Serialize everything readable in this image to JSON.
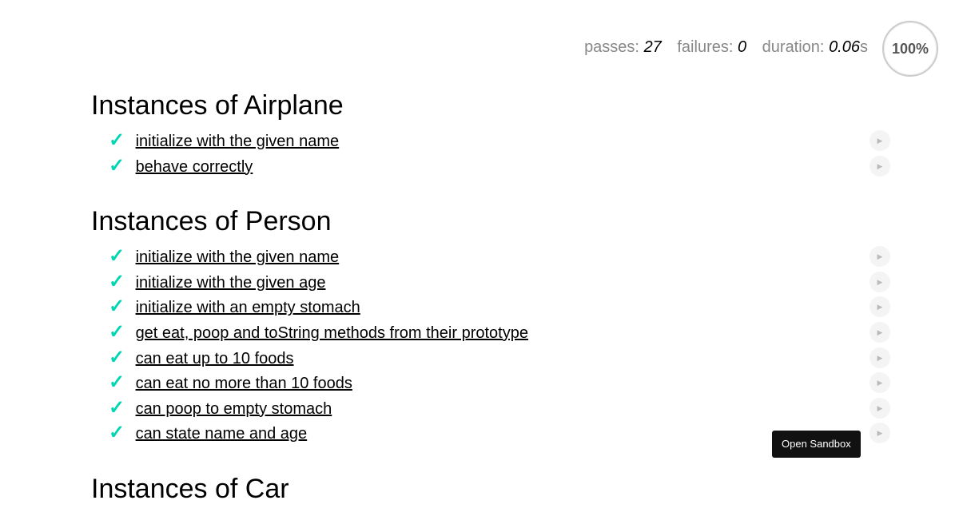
{
  "stats": {
    "passes_label": "passes:",
    "passes": "27",
    "failures_label": "failures:",
    "failures": "0",
    "duration_label": "duration:",
    "duration": "0.06",
    "duration_unit": "s",
    "progress": "100%"
  },
  "suites": [
    {
      "title": "Instances of Airplane",
      "tests": [
        {
          "title": "initialize with the given name",
          "status": "passed"
        },
        {
          "title": "behave correctly",
          "status": "passed"
        }
      ]
    },
    {
      "title": "Instances of Person",
      "tests": [
        {
          "title": "initialize with the given name",
          "status": "passed"
        },
        {
          "title": "initialize with the given age",
          "status": "passed"
        },
        {
          "title": "initialize with an empty stomach",
          "status": "passed"
        },
        {
          "title": "get eat, poop and toString methods from their prototype",
          "status": "passed"
        },
        {
          "title": "can eat up to 10 foods",
          "status": "passed"
        },
        {
          "title": "can eat no more than 10 foods",
          "status": "passed"
        },
        {
          "title": "can poop to empty stomach",
          "status": "passed"
        },
        {
          "title": "can state name and age",
          "status": "passed"
        }
      ]
    },
    {
      "title": "Instances of Car",
      "tests": []
    }
  ],
  "icons": {
    "check": "✓",
    "replay": "▶"
  },
  "tooltip": {
    "text": "Open Sandbox"
  },
  "colors": {
    "pass": "#00d6b2",
    "tooltip_bg": "#111111"
  }
}
